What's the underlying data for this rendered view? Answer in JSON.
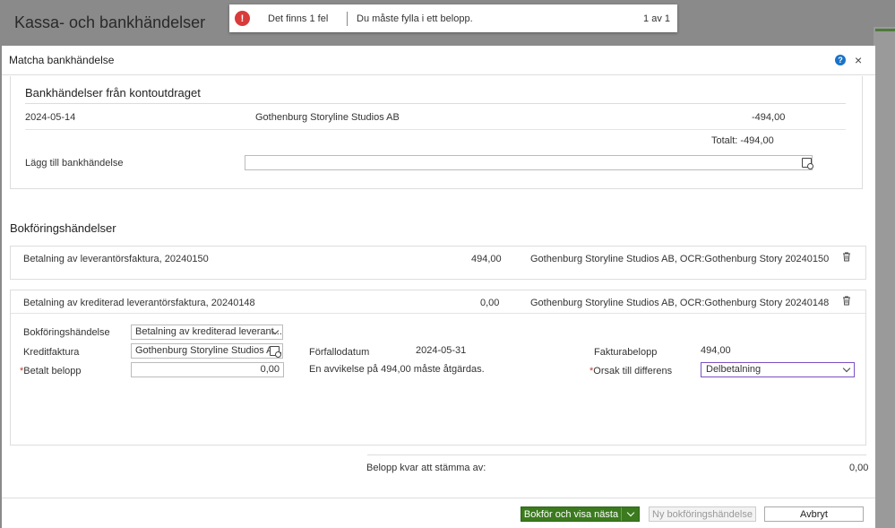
{
  "background": {
    "page_title": "Kassa- och bankhändelser"
  },
  "error": {
    "count_text": "Det finns 1 fel",
    "message": "Du måste fylla i ett belopp.",
    "pager": "1 av 1",
    "icon": "!"
  },
  "modal": {
    "title": "Matcha bankhändelse",
    "help": "?",
    "close": "×",
    "bank": {
      "heading": "Bankhändelser från kontoutdraget",
      "rows": [
        {
          "date": "2024-05-14",
          "name": "Gothenburg Storyline Studios AB",
          "amount": "-494,00"
        }
      ],
      "total": "Totalt: -494,00",
      "add_label": "Lägg till bankhändelse",
      "add_value": ""
    },
    "bookings": {
      "heading": "Bokföringshändelser",
      "events": [
        {
          "desc": "Betalning av leverantörsfaktura, 20240150",
          "amount": "494,00",
          "party": "Gothenburg Storyline Studios AB, OCR:Gothenburg Story 20240150"
        },
        {
          "desc": "Betalning av krediterad leverantörsfaktura, 20240148",
          "amount": "0,00",
          "party": "Gothenburg Storyline Studios AB, OCR:Gothenburg Story 20240148"
        }
      ],
      "form": {
        "type_label": "Bokföringshändelse",
        "type_value": "Betalning av krediterad leverant...",
        "credit_label": "Kreditfaktura",
        "credit_value": "Gothenburg Storyline Studios AB,",
        "paid_label": "Betalt belopp",
        "paid_value": "0,00",
        "due_label": "Förfallodatum",
        "due_value": "2024-05-31",
        "deviation_text": "En avvikelse på 494,00 måste åtgärdas.",
        "invoice_amount_label": "Fakturabelopp",
        "invoice_amount_value": "494,00",
        "reason_label": "Orsak till differens",
        "reason_value": "Delbetalning",
        "required_mark": "*"
      }
    },
    "remaining": {
      "label": "Belopp kvar att stämma av:",
      "value": "0,00"
    },
    "footer": {
      "primary": "Bokför och visa nästa",
      "new_event": "Ny bokföringshändelse",
      "cancel": "Avbryt"
    }
  }
}
